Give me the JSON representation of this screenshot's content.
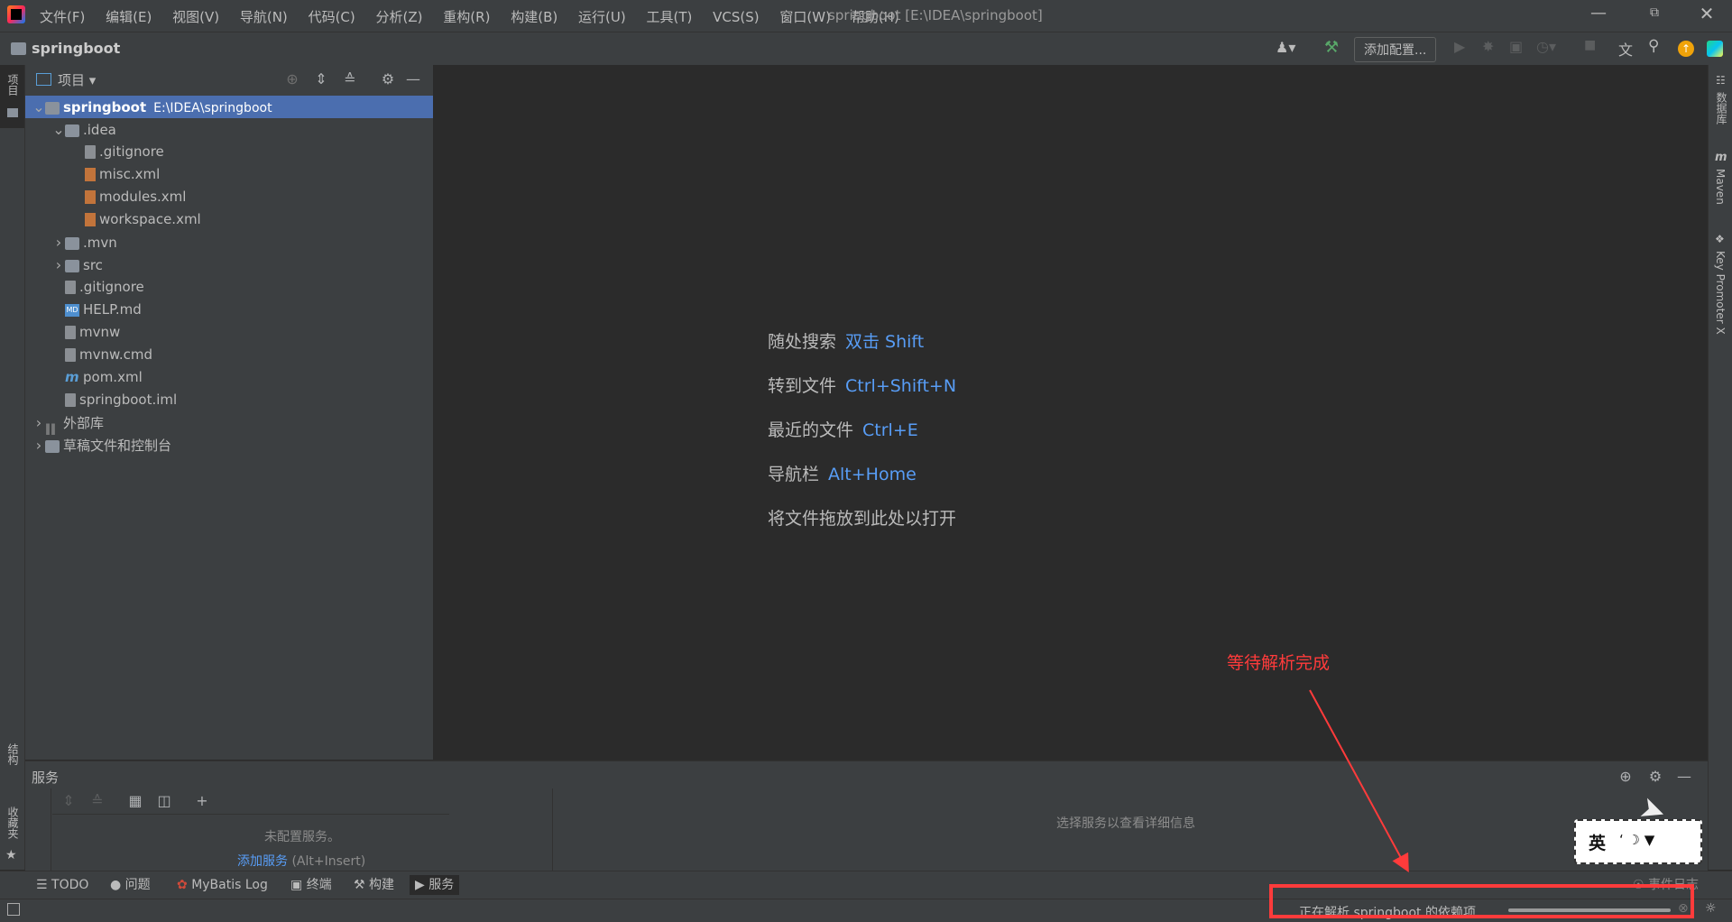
{
  "window": {
    "title": "springboot [E:\\IDEA\\springboot]",
    "app_icon": "intellij-logo",
    "menu": [
      "文件(F)",
      "编辑(E)",
      "视图(V)",
      "导航(N)",
      "代码(C)",
      "分析(Z)",
      "重构(R)",
      "构建(B)",
      "运行(U)",
      "工具(T)",
      "VCS(S)",
      "窗口(W)",
      "帮助(H)"
    ]
  },
  "navbar": {
    "breadcrumb": "springboot",
    "add_config_label": "添加配置..."
  },
  "left_strip": {
    "project_tab": "项目",
    "structure_tab": "结构",
    "favorites_tab": "收藏夹"
  },
  "right_strip": {
    "database_tab": "数据库",
    "maven_tab": "Maven",
    "key_promoter_tab": "Key Promoter X"
  },
  "project_panel": {
    "view_label": "项目",
    "tree": [
      {
        "label": "springboot",
        "path": "E:\\IDEA\\springboot",
        "depth": 0,
        "expanded": true,
        "icon": "module-folder-icon",
        "selected": true
      },
      {
        "label": ".idea",
        "depth": 1,
        "expanded": true,
        "icon": "folder-icon"
      },
      {
        "label": ".gitignore",
        "depth": 2,
        "icon": "gitignore-file-icon"
      },
      {
        "label": "misc.xml",
        "depth": 2,
        "icon": "xml-file-icon"
      },
      {
        "label": "modules.xml",
        "depth": 2,
        "icon": "xml-file-icon"
      },
      {
        "label": "workspace.xml",
        "depth": 2,
        "icon": "xml-file-icon"
      },
      {
        "label": ".mvn",
        "depth": 1,
        "expanded": false,
        "icon": "folder-icon"
      },
      {
        "label": "src",
        "depth": 1,
        "expanded": false,
        "icon": "folder-icon"
      },
      {
        "label": ".gitignore",
        "depth": 1,
        "icon": "gitignore-file-icon"
      },
      {
        "label": "HELP.md",
        "depth": 1,
        "icon": "markdown-file-icon"
      },
      {
        "label": "mvnw",
        "depth": 1,
        "icon": "script-file-icon"
      },
      {
        "label": "mvnw.cmd",
        "depth": 1,
        "icon": "text-file-icon"
      },
      {
        "label": "pom.xml",
        "depth": 1,
        "icon": "maven-file-icon"
      },
      {
        "label": "springboot.iml",
        "depth": 1,
        "icon": "iml-file-icon"
      },
      {
        "label": "外部库",
        "depth": 0,
        "expanded": false,
        "icon": "library-icon"
      },
      {
        "label": "草稿文件和控制台",
        "depth": 0,
        "expanded": false,
        "icon": "scratch-icon"
      }
    ]
  },
  "editor": {
    "hints": [
      {
        "label": "随处搜索",
        "key": "双击 Shift"
      },
      {
        "label": "转到文件",
        "key": "Ctrl+Shift+N"
      },
      {
        "label": "最近的文件",
        "key": "Ctrl+E"
      },
      {
        "label": "导航栏",
        "key": "Alt+Home"
      },
      {
        "label": "将文件拖放到此处以打开",
        "key": ""
      }
    ]
  },
  "services_panel": {
    "title": "服务",
    "empty_text": "未配置服务。",
    "add_service_link": "添加服务",
    "add_service_shortcut": "(Alt+Insert)",
    "detail_placeholder": "选择服务以查看详细信息"
  },
  "bottom_tabs": [
    {
      "label": "TODO",
      "icon": "list-icon"
    },
    {
      "label": "问题",
      "icon": "problems-icon"
    },
    {
      "label": "MyBatis Log",
      "icon": "mybatis-icon"
    },
    {
      "label": "终端",
      "icon": "terminal-icon"
    },
    {
      "label": "构建",
      "icon": "hammer-icon"
    },
    {
      "label": "服务",
      "icon": "services-icon",
      "active": true
    }
  ],
  "status_bar": {
    "progress_text": "正在解析 springboot 的依赖项...",
    "event_log_label": "事件日志"
  },
  "annotation": {
    "text": "等待解析完成",
    "color": "#ff3b3b"
  },
  "ime_widget": {
    "label": "英"
  },
  "colors": {
    "accent_blue": "#589df6",
    "selection": "#4b6eaf",
    "annotation_red": "#ff3b3b"
  }
}
